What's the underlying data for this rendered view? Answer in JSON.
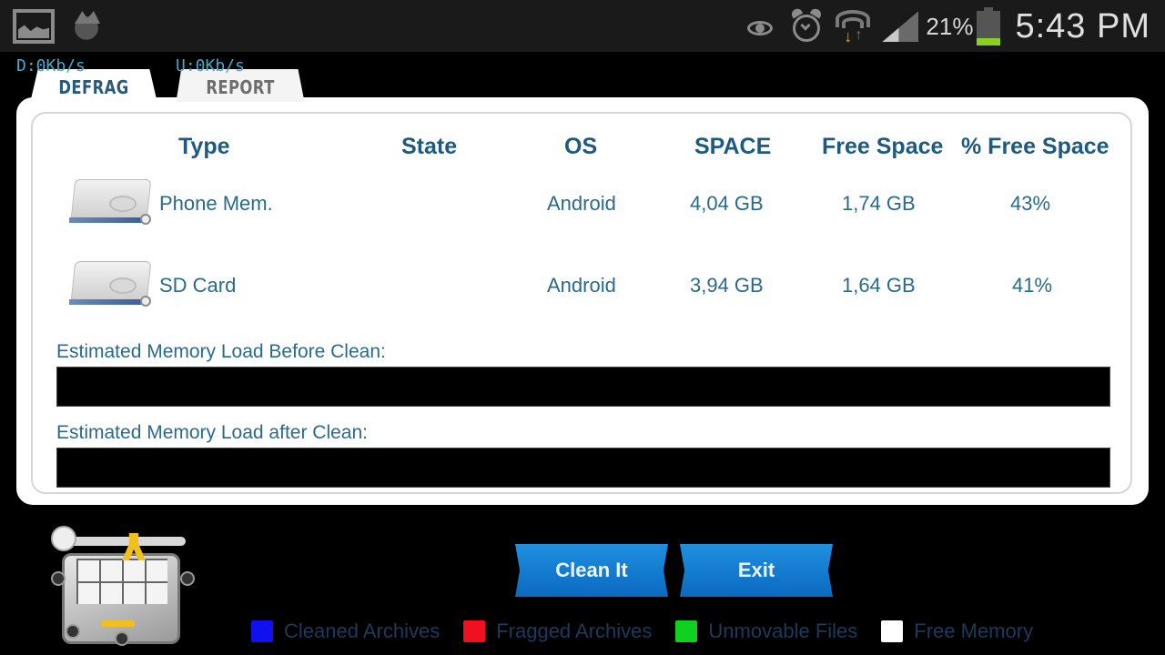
{
  "status_bar": {
    "left_icons": [
      "gallery-icon",
      "app-notification-icon"
    ],
    "right_icons": [
      "eye-icon",
      "alarm-icon",
      "wifi-icon",
      "signal-icon",
      "battery-icon"
    ],
    "battery_percent": "21%",
    "battery_level": 0.21,
    "battery_color": "#8ad020",
    "time": "5:43 PM"
  },
  "speed": {
    "download": "D:0Kb/s",
    "upload": "U:0Kb/s"
  },
  "tabs": [
    {
      "label": "DEFRAG",
      "active": true
    },
    {
      "label": "REPORT",
      "active": false
    }
  ],
  "table": {
    "headers": [
      "Type",
      "State",
      "OS",
      "SPACE",
      "Free Space",
      "% Free Space"
    ],
    "rows": [
      {
        "icon": "drive-icon",
        "type": "Phone Mem.",
        "state": "",
        "os": "Android",
        "space": "4,04 GB",
        "free": "1,74 GB",
        "pct_free": "43%"
      },
      {
        "icon": "drive-icon",
        "type": "SD Card",
        "state": "",
        "os": "Android",
        "space": "3,94 GB",
        "free": "1,64 GB",
        "pct_free": "41%"
      }
    ]
  },
  "memory_load": {
    "before_label": "Estimated Memory Load Before Clean:",
    "after_label": "Estimated Memory Load after Clean:"
  },
  "buttons": {
    "clean": "Clean It",
    "exit": "Exit"
  },
  "legend": [
    {
      "label": "Cleaned Archives",
      "color": "#1010f0"
    },
    {
      "label": "Fragged Archives",
      "color": "#f01020"
    },
    {
      "label": "Unmovable Files",
      "color": "#10d020"
    },
    {
      "label": "Free Memory",
      "color": "#ffffff"
    }
  ],
  "colors": {
    "accent": "#1f8fe0",
    "header_text": "#1e5a7e",
    "cell_text": "#2a6a8a"
  }
}
